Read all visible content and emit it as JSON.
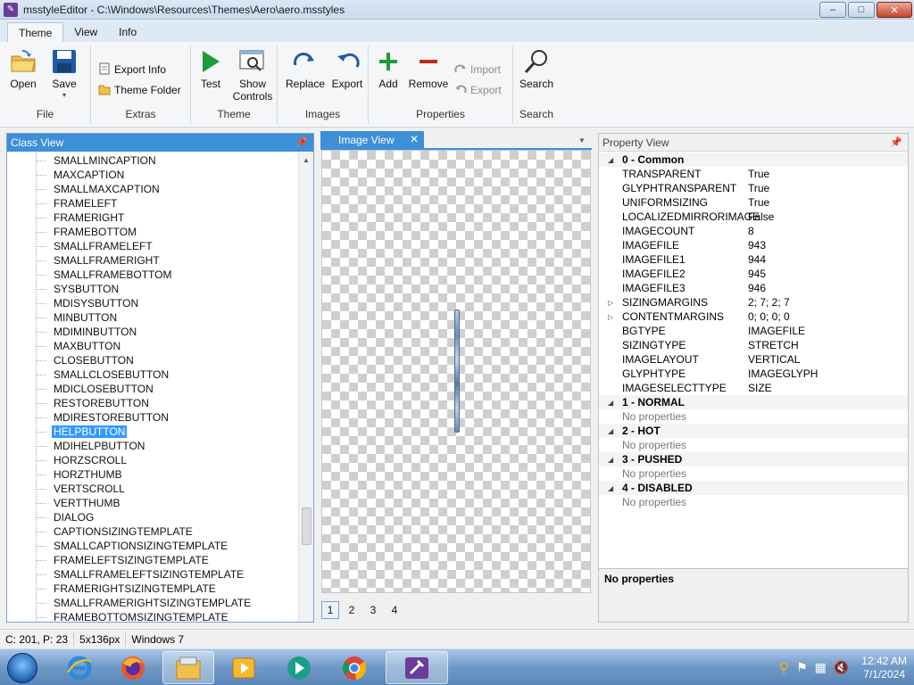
{
  "window": {
    "title": "msstyleEditor - C:\\Windows\\Resources\\Themes\\Aero\\aero.msstyles",
    "min": "–",
    "max": "□",
    "close": "✕"
  },
  "tabs": [
    "Theme",
    "View",
    "Info"
  ],
  "ribbon": {
    "file": {
      "label": "File",
      "open": "Open",
      "save": "Save"
    },
    "extras": {
      "label": "Extras",
      "export_info": "Export Info",
      "theme_folder": "Theme Folder"
    },
    "theme": {
      "label": "Theme",
      "test": "Test",
      "show_controls": "Show Controls"
    },
    "images": {
      "label": "Images",
      "replace": "Replace",
      "export": "Export"
    },
    "properties": {
      "label": "Properties",
      "add": "Add",
      "remove": "Remove",
      "import": "Import",
      "export": "Export"
    },
    "search": {
      "label": "Search",
      "search": "Search"
    }
  },
  "class_view": {
    "title": "Class View",
    "items": [
      "SMALLMINCAPTION",
      "MAXCAPTION",
      "SMALLMAXCAPTION",
      "FRAMELEFT",
      "FRAMERIGHT",
      "FRAMEBOTTOM",
      "SMALLFRAMELEFT",
      "SMALLFRAMERIGHT",
      "SMALLFRAMEBOTTOM",
      "SYSBUTTON",
      "MDISYSBUTTON",
      "MINBUTTON",
      "MDIMINBUTTON",
      "MAXBUTTON",
      "CLOSEBUTTON",
      "SMALLCLOSEBUTTON",
      "MDICLOSEBUTTON",
      "RESTOREBUTTON",
      "MDIRESTOREBUTTON",
      "HELPBUTTON",
      "MDIHELPBUTTON",
      "HORZSCROLL",
      "HORZTHUMB",
      "VERTSCROLL",
      "VERTTHUMB",
      "DIALOG",
      "CAPTIONSIZINGTEMPLATE",
      "SMALLCAPTIONSIZINGTEMPLATE",
      "FRAMELEFTSIZINGTEMPLATE",
      "SMALLFRAMELEFTSIZINGTEMPLATE",
      "FRAMERIGHTSIZINGTEMPLATE",
      "SMALLFRAMERIGHTSIZINGTEMPLATE",
      "FRAMEBOTTOMSIZINGTEMPLATE"
    ],
    "selected": "HELPBUTTON"
  },
  "image_view": {
    "title": "Image View",
    "close": "✕",
    "pages": [
      "1",
      "2",
      "3",
      "4"
    ],
    "active_page": "1"
  },
  "property_view": {
    "title": "Property View",
    "sections": [
      {
        "name": "0 - Common",
        "rows": [
          {
            "name": "TRANSPARENT",
            "value": "True"
          },
          {
            "name": "GLYPHTRANSPARENT",
            "value": "True"
          },
          {
            "name": "UNIFORMSIZING",
            "value": "True"
          },
          {
            "name": "LOCALIZEDMIRRORIMAGE",
            "value": "False"
          },
          {
            "name": "IMAGECOUNT",
            "value": "8"
          },
          {
            "name": "IMAGEFILE",
            "value": "943"
          },
          {
            "name": "IMAGEFILE1",
            "value": "944"
          },
          {
            "name": "IMAGEFILE2",
            "value": "945"
          },
          {
            "name": "IMAGEFILE3",
            "value": "946"
          },
          {
            "name": "SIZINGMARGINS",
            "value": "2; 7; 2; 7",
            "expandable": true
          },
          {
            "name": "CONTENTMARGINS",
            "value": "0; 0; 0; 0",
            "expandable": true
          },
          {
            "name": "BGTYPE",
            "value": "IMAGEFILE"
          },
          {
            "name": "SIZINGTYPE",
            "value": "STRETCH"
          },
          {
            "name": "IMAGELAYOUT",
            "value": "VERTICAL"
          },
          {
            "name": "GLYPHTYPE",
            "value": "IMAGEGLYPH"
          },
          {
            "name": "IMAGESELECTTYPE",
            "value": "SIZE"
          }
        ]
      },
      {
        "name": "1 - NORMAL",
        "empty": "No properties"
      },
      {
        "name": "2 - HOT",
        "empty": "No properties"
      },
      {
        "name": "3 - PUSHED",
        "empty": "No properties"
      },
      {
        "name": "4 - DISABLED",
        "empty": "No properties"
      }
    ],
    "description": "No properties"
  },
  "status": {
    "cursor": "C: 201, P: 23",
    "size": "5x136px",
    "platform": "Windows 7"
  },
  "taskbar": {
    "time": "12:42 AM",
    "date": "7/1/2024"
  },
  "colors": {
    "accent": "#3d8fd8",
    "selection": "#3399ff"
  }
}
